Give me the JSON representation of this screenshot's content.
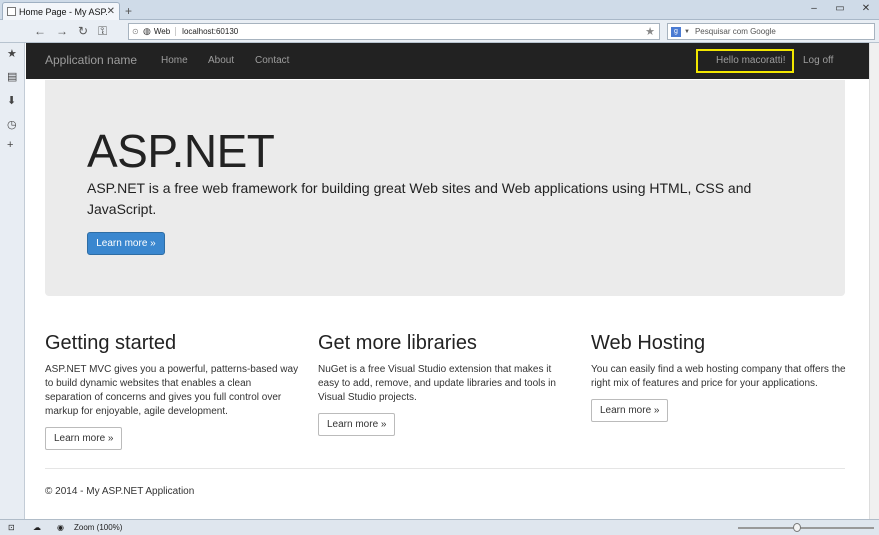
{
  "browser": {
    "tab_title": "Home Page - My ASP....",
    "tab_close": "✕",
    "new_tab": "+",
    "url_label": "Web",
    "url": "localhost:60130",
    "search_placeholder": "Pesquisar com Google"
  },
  "navbar": {
    "brand": "Application name",
    "links": [
      "Home",
      "About",
      "Contact"
    ],
    "greeting": "Hello macoratti!",
    "logoff": "Log off"
  },
  "jumbotron": {
    "title": "ASP.NET",
    "lead": "ASP.NET is a free web framework for building great Web sites and Web applications using HTML, CSS and JavaScript.",
    "button": "Learn more »"
  },
  "columns": [
    {
      "title": "Getting started",
      "text": "ASP.NET MVC gives you a powerful, patterns-based way to build dynamic websites that enables a clean separation of concerns and gives you full control over markup for enjoyable, agile development.",
      "button": "Learn more »"
    },
    {
      "title": "Get more libraries",
      "text": "NuGet is a free Visual Studio extension that makes it easy to add, remove, and update libraries and tools in Visual Studio projects.",
      "button": "Learn more »"
    },
    {
      "title": "Web Hosting",
      "text": "You can easily find a web hosting company that offers the right mix of features and price for your applications.",
      "button": "Learn more »"
    }
  ],
  "footer": "© 2014 - My ASP.NET Application",
  "status": {
    "zoom": "Zoom (100%)"
  },
  "colors": {
    "navbar_bg": "#222222",
    "highlight_box": "#f2e600",
    "arrow": "#1a1fb8",
    "primary_button": "#3a87cf"
  }
}
